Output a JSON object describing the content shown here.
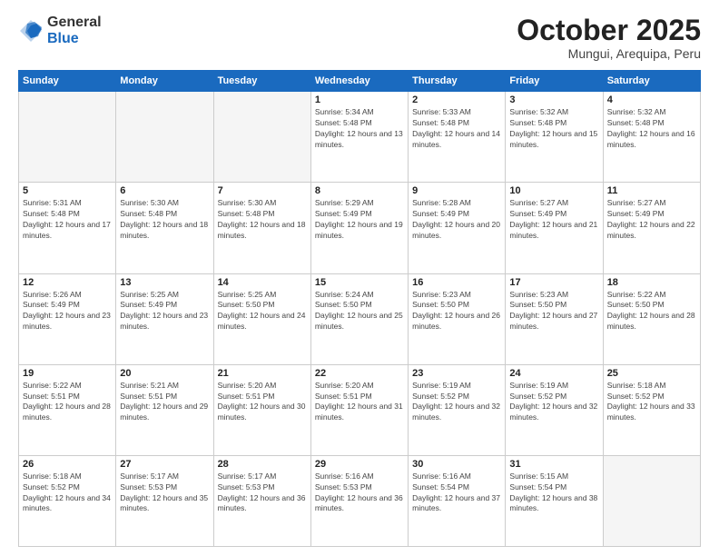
{
  "header": {
    "logo_general": "General",
    "logo_blue": "Blue",
    "month_title": "October 2025",
    "location": "Mungui, Arequipa, Peru"
  },
  "weekdays": [
    "Sunday",
    "Monday",
    "Tuesday",
    "Wednesday",
    "Thursday",
    "Friday",
    "Saturday"
  ],
  "weeks": [
    [
      {
        "day": "",
        "sunrise": "",
        "sunset": "",
        "daylight": "",
        "empty": true
      },
      {
        "day": "",
        "sunrise": "",
        "sunset": "",
        "daylight": "",
        "empty": true
      },
      {
        "day": "",
        "sunrise": "",
        "sunset": "",
        "daylight": "",
        "empty": true
      },
      {
        "day": "1",
        "sunrise": "Sunrise: 5:34 AM",
        "sunset": "Sunset: 5:48 PM",
        "daylight": "Daylight: 12 hours and 13 minutes.",
        "empty": false
      },
      {
        "day": "2",
        "sunrise": "Sunrise: 5:33 AM",
        "sunset": "Sunset: 5:48 PM",
        "daylight": "Daylight: 12 hours and 14 minutes.",
        "empty": false
      },
      {
        "day": "3",
        "sunrise": "Sunrise: 5:32 AM",
        "sunset": "Sunset: 5:48 PM",
        "daylight": "Daylight: 12 hours and 15 minutes.",
        "empty": false
      },
      {
        "day": "4",
        "sunrise": "Sunrise: 5:32 AM",
        "sunset": "Sunset: 5:48 PM",
        "daylight": "Daylight: 12 hours and 16 minutes.",
        "empty": false
      }
    ],
    [
      {
        "day": "5",
        "sunrise": "Sunrise: 5:31 AM",
        "sunset": "Sunset: 5:48 PM",
        "daylight": "Daylight: 12 hours and 17 minutes.",
        "empty": false
      },
      {
        "day": "6",
        "sunrise": "Sunrise: 5:30 AM",
        "sunset": "Sunset: 5:48 PM",
        "daylight": "Daylight: 12 hours and 18 minutes.",
        "empty": false
      },
      {
        "day": "7",
        "sunrise": "Sunrise: 5:30 AM",
        "sunset": "Sunset: 5:48 PM",
        "daylight": "Daylight: 12 hours and 18 minutes.",
        "empty": false
      },
      {
        "day": "8",
        "sunrise": "Sunrise: 5:29 AM",
        "sunset": "Sunset: 5:49 PM",
        "daylight": "Daylight: 12 hours and 19 minutes.",
        "empty": false
      },
      {
        "day": "9",
        "sunrise": "Sunrise: 5:28 AM",
        "sunset": "Sunset: 5:49 PM",
        "daylight": "Daylight: 12 hours and 20 minutes.",
        "empty": false
      },
      {
        "day": "10",
        "sunrise": "Sunrise: 5:27 AM",
        "sunset": "Sunset: 5:49 PM",
        "daylight": "Daylight: 12 hours and 21 minutes.",
        "empty": false
      },
      {
        "day": "11",
        "sunrise": "Sunrise: 5:27 AM",
        "sunset": "Sunset: 5:49 PM",
        "daylight": "Daylight: 12 hours and 22 minutes.",
        "empty": false
      }
    ],
    [
      {
        "day": "12",
        "sunrise": "Sunrise: 5:26 AM",
        "sunset": "Sunset: 5:49 PM",
        "daylight": "Daylight: 12 hours and 23 minutes.",
        "empty": false
      },
      {
        "day": "13",
        "sunrise": "Sunrise: 5:25 AM",
        "sunset": "Sunset: 5:49 PM",
        "daylight": "Daylight: 12 hours and 23 minutes.",
        "empty": false
      },
      {
        "day": "14",
        "sunrise": "Sunrise: 5:25 AM",
        "sunset": "Sunset: 5:50 PM",
        "daylight": "Daylight: 12 hours and 24 minutes.",
        "empty": false
      },
      {
        "day": "15",
        "sunrise": "Sunrise: 5:24 AM",
        "sunset": "Sunset: 5:50 PM",
        "daylight": "Daylight: 12 hours and 25 minutes.",
        "empty": false
      },
      {
        "day": "16",
        "sunrise": "Sunrise: 5:23 AM",
        "sunset": "Sunset: 5:50 PM",
        "daylight": "Daylight: 12 hours and 26 minutes.",
        "empty": false
      },
      {
        "day": "17",
        "sunrise": "Sunrise: 5:23 AM",
        "sunset": "Sunset: 5:50 PM",
        "daylight": "Daylight: 12 hours and 27 minutes.",
        "empty": false
      },
      {
        "day": "18",
        "sunrise": "Sunrise: 5:22 AM",
        "sunset": "Sunset: 5:50 PM",
        "daylight": "Daylight: 12 hours and 28 minutes.",
        "empty": false
      }
    ],
    [
      {
        "day": "19",
        "sunrise": "Sunrise: 5:22 AM",
        "sunset": "Sunset: 5:51 PM",
        "daylight": "Daylight: 12 hours and 28 minutes.",
        "empty": false
      },
      {
        "day": "20",
        "sunrise": "Sunrise: 5:21 AM",
        "sunset": "Sunset: 5:51 PM",
        "daylight": "Daylight: 12 hours and 29 minutes.",
        "empty": false
      },
      {
        "day": "21",
        "sunrise": "Sunrise: 5:20 AM",
        "sunset": "Sunset: 5:51 PM",
        "daylight": "Daylight: 12 hours and 30 minutes.",
        "empty": false
      },
      {
        "day": "22",
        "sunrise": "Sunrise: 5:20 AM",
        "sunset": "Sunset: 5:51 PM",
        "daylight": "Daylight: 12 hours and 31 minutes.",
        "empty": false
      },
      {
        "day": "23",
        "sunrise": "Sunrise: 5:19 AM",
        "sunset": "Sunset: 5:52 PM",
        "daylight": "Daylight: 12 hours and 32 minutes.",
        "empty": false
      },
      {
        "day": "24",
        "sunrise": "Sunrise: 5:19 AM",
        "sunset": "Sunset: 5:52 PM",
        "daylight": "Daylight: 12 hours and 32 minutes.",
        "empty": false
      },
      {
        "day": "25",
        "sunrise": "Sunrise: 5:18 AM",
        "sunset": "Sunset: 5:52 PM",
        "daylight": "Daylight: 12 hours and 33 minutes.",
        "empty": false
      }
    ],
    [
      {
        "day": "26",
        "sunrise": "Sunrise: 5:18 AM",
        "sunset": "Sunset: 5:52 PM",
        "daylight": "Daylight: 12 hours and 34 minutes.",
        "empty": false
      },
      {
        "day": "27",
        "sunrise": "Sunrise: 5:17 AM",
        "sunset": "Sunset: 5:53 PM",
        "daylight": "Daylight: 12 hours and 35 minutes.",
        "empty": false
      },
      {
        "day": "28",
        "sunrise": "Sunrise: 5:17 AM",
        "sunset": "Sunset: 5:53 PM",
        "daylight": "Daylight: 12 hours and 36 minutes.",
        "empty": false
      },
      {
        "day": "29",
        "sunrise": "Sunrise: 5:16 AM",
        "sunset": "Sunset: 5:53 PM",
        "daylight": "Daylight: 12 hours and 36 minutes.",
        "empty": false
      },
      {
        "day": "30",
        "sunrise": "Sunrise: 5:16 AM",
        "sunset": "Sunset: 5:54 PM",
        "daylight": "Daylight: 12 hours and 37 minutes.",
        "empty": false
      },
      {
        "day": "31",
        "sunrise": "Sunrise: 5:15 AM",
        "sunset": "Sunset: 5:54 PM",
        "daylight": "Daylight: 12 hours and 38 minutes.",
        "empty": false
      },
      {
        "day": "",
        "sunrise": "",
        "sunset": "",
        "daylight": "",
        "empty": true
      }
    ]
  ]
}
